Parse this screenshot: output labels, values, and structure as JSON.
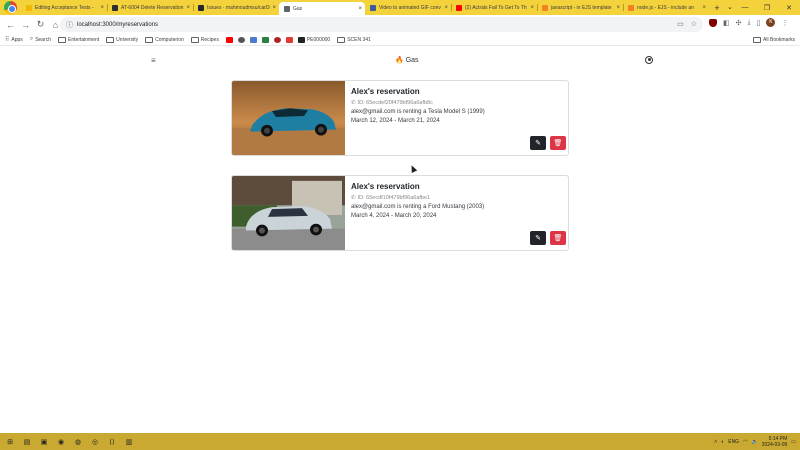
{
  "browser": {
    "tabs": [
      {
        "title": "Editing Acceptance Tests -",
        "favicon_color": "#f2b705",
        "active": false
      },
      {
        "title": "AT-6004 Delete Reservation",
        "favicon_color": "#2e2e2e",
        "active": false
      },
      {
        "title": "Issues · mahmoudmsu/carDi",
        "favicon_color": "#24292f",
        "active": false
      },
      {
        "title": "Gas",
        "favicon_color": "#5f6368",
        "active": true
      },
      {
        "title": "Video to animated GIF conv",
        "favicon_color": "#3d5a99",
        "active": false
      },
      {
        "title": "(2) Actrals Fail To Get To Th",
        "favicon_color": "#ff0000",
        "active": false
      },
      {
        "title": "javascript - in EJS template",
        "favicon_color": "#f48024",
        "active": false
      },
      {
        "title": "node.js - EJS - include an",
        "favicon_color": "#f48024",
        "active": false
      }
    ],
    "url": "localhost:3000/myreservations",
    "bookmarks": [
      "Apps",
      "Search",
      "Entertainment",
      "University",
      "Computerion",
      "Recipes",
      "PE000000",
      "SCEN 341"
    ],
    "all_bookmarks_label": "All Bookmarks",
    "profile_initial": "K"
  },
  "app": {
    "brand": "Gas",
    "reservations": [
      {
        "title": "Alex's reservation",
        "id_text": "ID: 65ecdef20f479bf96a6afb8c",
        "renting_text": "alex@gmail.com is renting a Tesla Model S (1999)",
        "dates_text": "March 12, 2024 - March 21, 2024",
        "image": "blue sports car on desert road"
      },
      {
        "title": "Alex's reservation",
        "id_text": "ID: 65ecdf10f479bf96a6afbe1",
        "renting_text": "alex@gmail.com is renting a Ford Mustang (2003)",
        "dates_text": "March 4, 2024 - March 20, 2024",
        "image": "silver hatchback in driveway"
      }
    ]
  },
  "taskbar": {
    "language": "ENG",
    "time": "5:14 PM",
    "date": "2024-03-09"
  },
  "colors": {
    "tabstrip": "#f4d23c",
    "taskbar": "#c9a931",
    "edit_button": "#212529",
    "delete_button": "#dc3545"
  }
}
